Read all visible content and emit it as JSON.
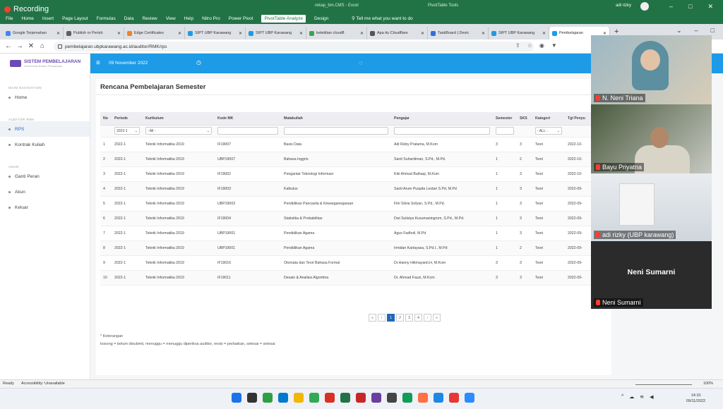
{
  "excel": {
    "recording": "Recording",
    "document": "rekap_bm.CMS - Excel",
    "tools": "PivotTable Tools",
    "ribbon_tabs": [
      "File",
      "Home",
      "Insert",
      "Page Layout",
      "Formulas",
      "Data",
      "Review",
      "View",
      "Help",
      "Nitro Pro",
      "Power Pivot",
      "PivotTable Analyze",
      "Design"
    ],
    "active_tab": "PivotTable Analyze",
    "tell_me": "Tell me what you want to do",
    "user": "adi rizky",
    "status_ready": "Ready",
    "status_accessibility": "Accessibility: Unavailable",
    "zoom": "100%"
  },
  "browser": {
    "tabs": [
      {
        "title": "Google Terjemahan",
        "color": "#4285f4"
      },
      {
        "title": "Publish or Perish",
        "color": "#5e5e5e"
      },
      {
        "title": "Edge Certificates",
        "color": "#f48120"
      },
      {
        "title": "SIPT UBP Karawang",
        "color": "#1d9be6"
      },
      {
        "title": "SIPT UBP Karawang",
        "color": "#1d9be6"
      },
      {
        "title": "ketetitian cloudfl",
        "color": "#34a853"
      },
      {
        "title": "Apa itu Cloudflare",
        "color": "#555555"
      },
      {
        "title": "TaskBoard | Devic",
        "color": "#2f6fde"
      },
      {
        "title": "SIPT UBP Karawang",
        "color": "#1d9be6"
      },
      {
        "title": "Pembelajaran",
        "color": "#1d9be6"
      }
    ],
    "url": "pembelajaran.ubpkarawang.ac.id/auditor/RMK/rps"
  },
  "app": {
    "logo_title": "SISTEM PEMBELAJARAN",
    "logo_sub": "Universitas Buana Perjuangan",
    "sections": [
      {
        "label": "MAIN NAVIGATION",
        "items": [
          "Home"
        ]
      },
      {
        "label": "AUDITOR RMK",
        "items": [
          "RPS",
          "Kontrak Kuliah"
        ]
      },
      {
        "label": "AKUN",
        "items": [
          "Ganti Peran",
          "Akun",
          "Keluar"
        ]
      }
    ],
    "active_item": "RPS",
    "topbar_date": "09 November 2022",
    "page_title": "Rencana Pembelajaran Semester",
    "columns": [
      "No",
      "Periode",
      "Kurikulum",
      "Kode MK",
      "Matakuliah",
      "Pengajar",
      "Semester",
      "SKS",
      "Kategori",
      "Tgl Penyu"
    ],
    "filters": {
      "periode": "2022-1",
      "kurikulum": "- All -",
      "kategori": "- ALL -"
    },
    "rows": [
      [
        "1",
        "2022-1",
        "Teknik Informatika 2019",
        "IF19007",
        "Basis Data",
        "Adi Rizky Pratama, M.Kom",
        "3",
        "3",
        "Teori",
        "2022-10-"
      ],
      [
        "2",
        "2022-1",
        "Teknik Informatika 2019",
        "UBP19007",
        "Bahasa Inggris",
        "Santi Suhardiman, S.Pd., M.Pd.",
        "1",
        "2",
        "Teori",
        "2022-10-"
      ],
      [
        "3",
        "2022-1",
        "Teknik Informatika 2019",
        "IF19002",
        "Pengantar Teknologi Informasi",
        "Kiki Ahmad Baihaqi, M.Kom",
        "1",
        "3",
        "Teori",
        "2022-10-"
      ],
      [
        "4",
        "2022-1",
        "Teknik Informatika 2019",
        "IF19003",
        "Kalkulus",
        "Santi Arum Puspita Lestari S.Pd, M.Pd",
        "1",
        "3",
        "Teori",
        "2022-09-"
      ],
      [
        "5",
        "2022-1",
        "Teknik Informatika 2019",
        "UBP19003",
        "Pendidikan Pancasila &amp; Kewarganegaraan",
        "Fitri Silvia Sofyan, S.Pd., M.Pd.",
        "1",
        "3",
        "Teori",
        "2022-09-"
      ],
      [
        "6",
        "2022-1",
        "Teknik Informatika 2019",
        "IF19004",
        "Statistika &amp; Probabilitas",
        "Dwi Sulistya Kusumaningrum, S.Pd., M.Pd.",
        "1",
        "3",
        "Teori",
        "2022-09-"
      ],
      [
        "7",
        "2022-1",
        "Teknik Informatika 2019",
        "UBP19001",
        "Pendidikan Agama",
        "Agus Fadholi, M.Pd",
        "1",
        "3",
        "Teori",
        "2022-09-"
      ],
      [
        "8",
        "2022-1",
        "Teknik Informatika 2019",
        "UBP19001",
        "Pendidikan Agama",
        "Irmidan Kartayasa, S.Pd.I., M.Pd",
        "1",
        "2",
        "Teori",
        "2022-09-"
      ],
      [
        "9",
        "2022-1",
        "Teknik Informatika 2019",
        "IF19016",
        "Otomata dan Teori Bahasa Formal",
        "Dr.Hanny Hikmayanti.H, M.Kom",
        "3",
        "3",
        "Teori",
        "2022-09-"
      ],
      [
        "10",
        "2022-1",
        "Teknik Informatika 2019",
        "IF19011",
        "Desain &amp; Analisis Algoritma",
        "Dr. Ahmad Fauzi, M.Kom",
        "3",
        "3",
        "Teori",
        "2022-09-"
      ]
    ],
    "pager": [
      "«",
      "‹",
      "1",
      "2",
      "3",
      "4",
      "›",
      "»"
    ],
    "active_page": "1",
    "note_title": "* Keterangan",
    "note_body": "kosong = belum disubmit, menuggu = menuggu diperiksa auditor, revisi = perbaikan, selesai = selesai"
  },
  "video": {
    "participants": [
      "N. Neni Triana",
      "Bayu Priyatna",
      "adi rizky (UBP karawang)",
      "Neni Sumarni"
    ],
    "featured_name": "Neni Sumarni"
  },
  "taskbar": {
    "time": "14:10",
    "date": "09/11/2022"
  }
}
